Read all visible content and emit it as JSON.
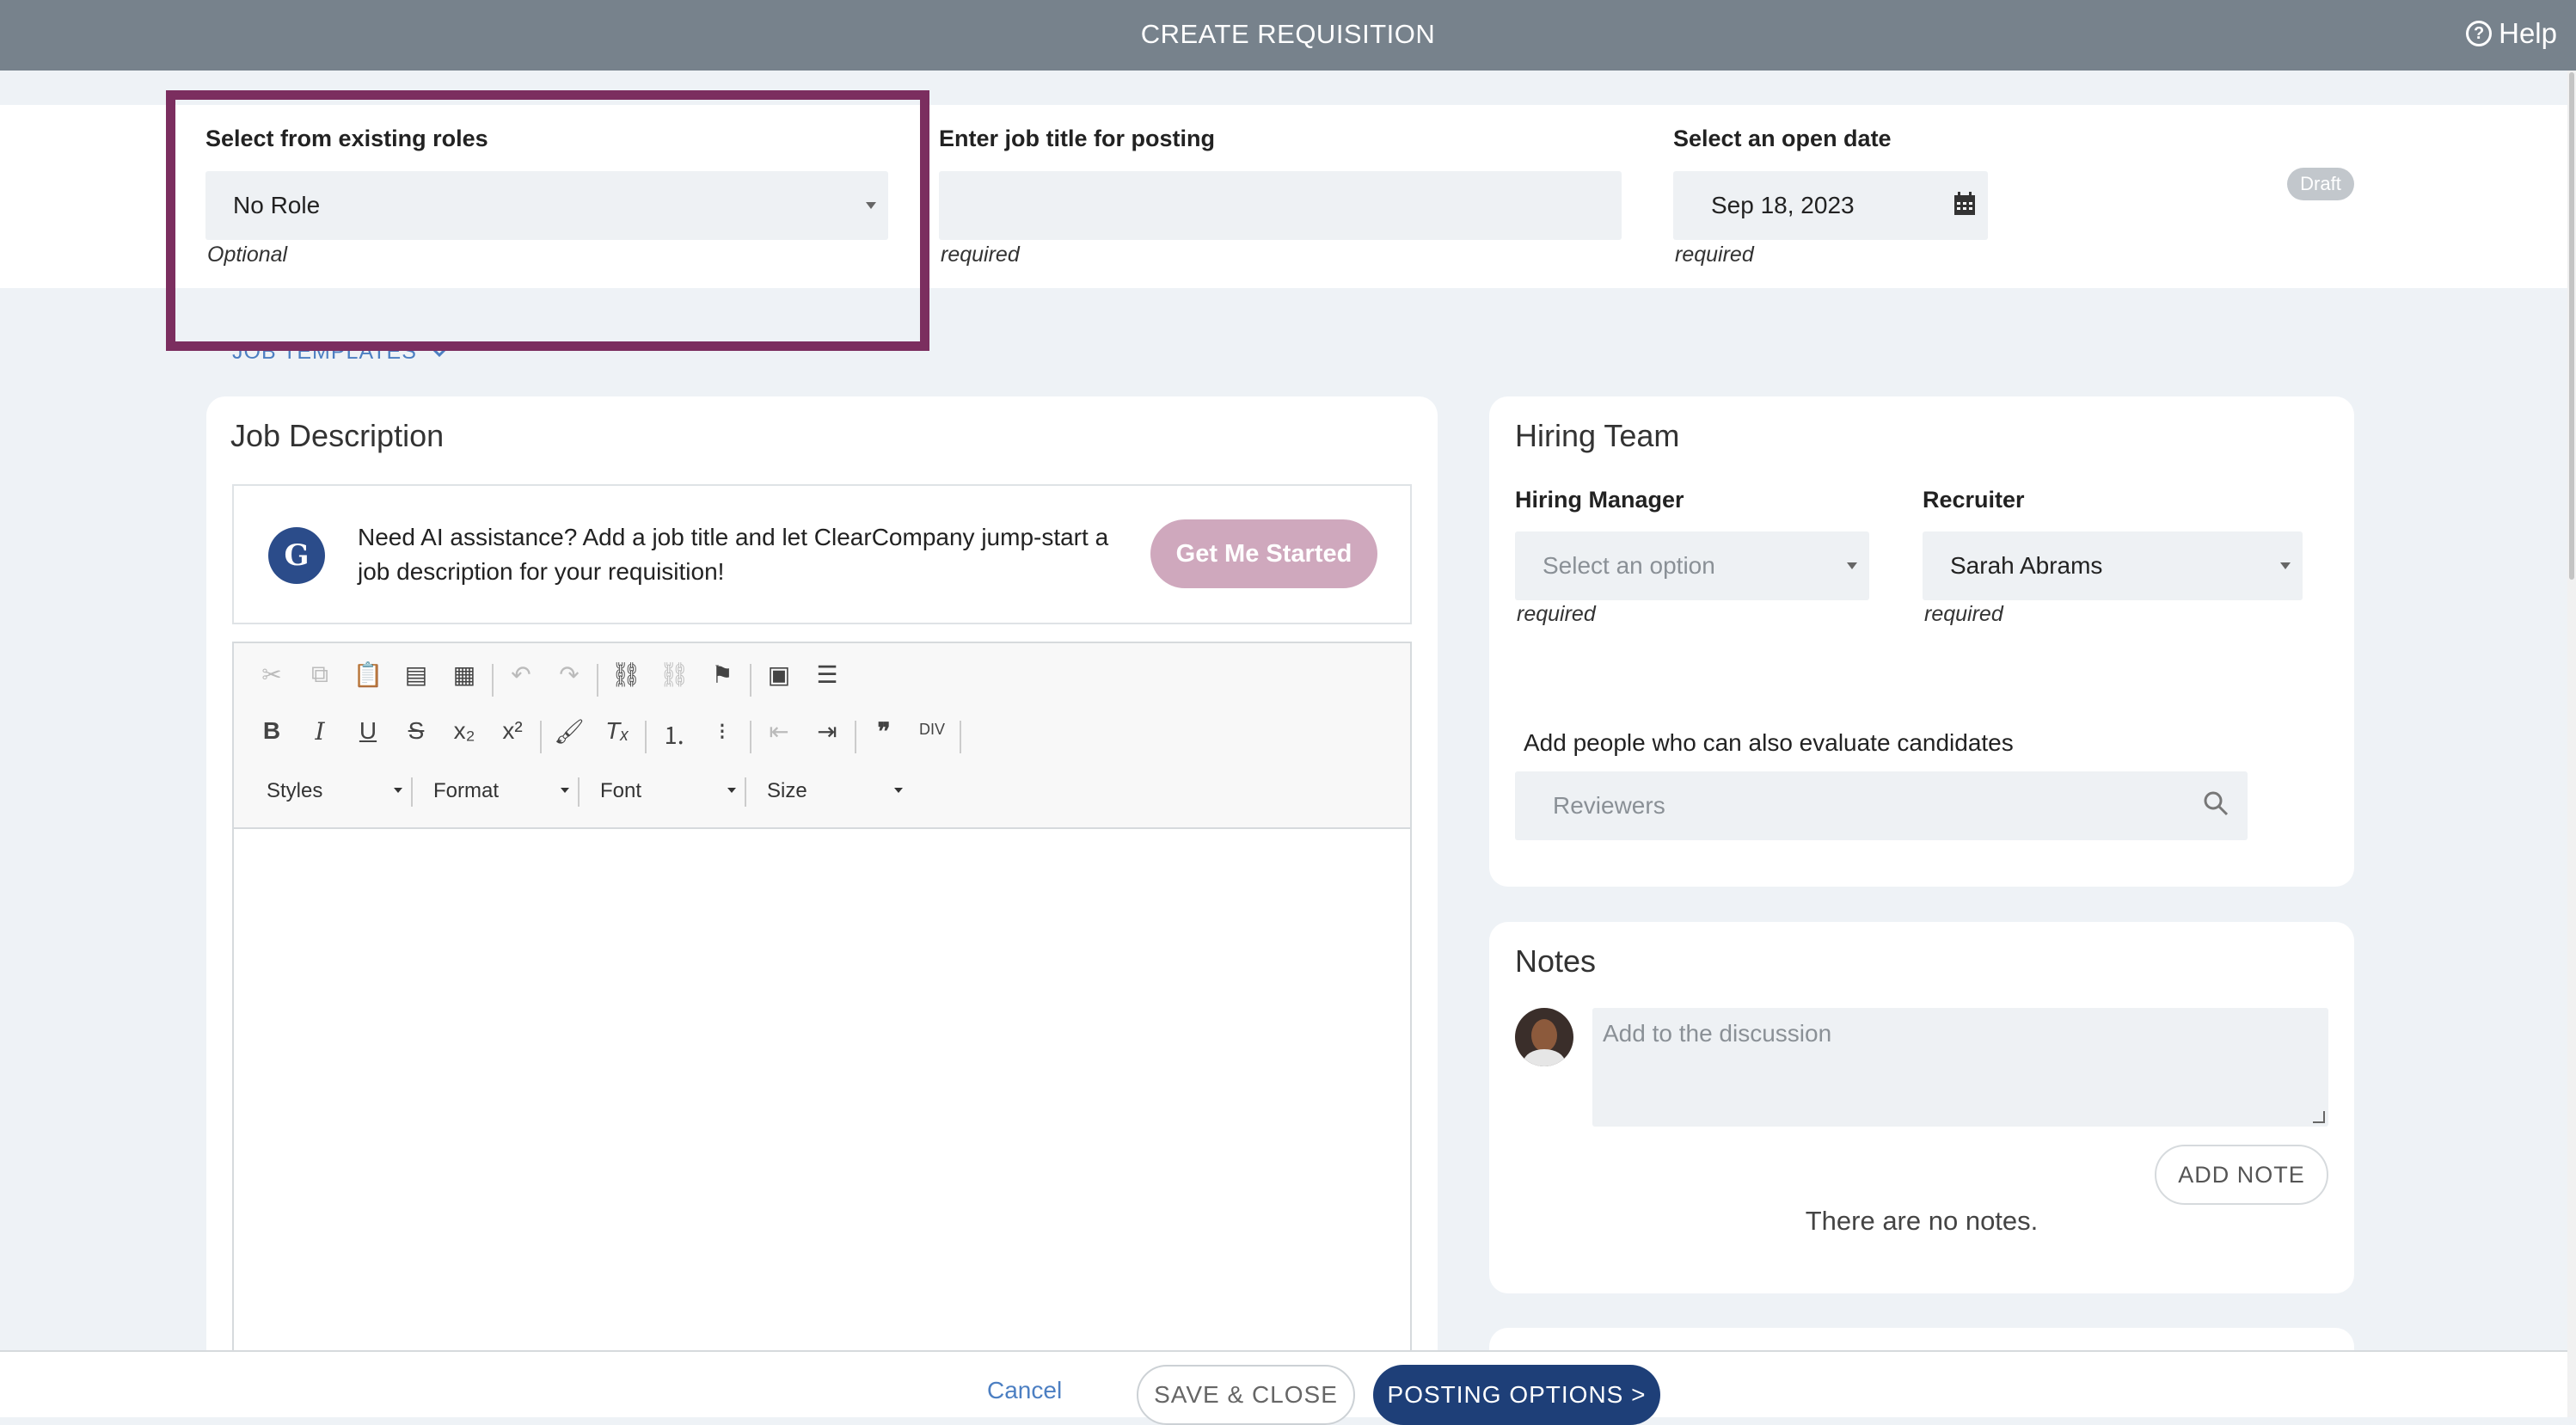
{
  "header": {
    "title": "CREATE REQUISITION",
    "help_label": "Help"
  },
  "top_fields": {
    "roles": {
      "label": "Select from existing roles",
      "value": "No Role",
      "hint": "Optional"
    },
    "job_title": {
      "label": "Enter job title for posting",
      "value": "",
      "hint": "required"
    },
    "open_date": {
      "label": "Select an open date",
      "value": "Sep 18, 2023",
      "hint": "required"
    },
    "status_badge": "Draft"
  },
  "job_templates_label": "JOB TEMPLATES",
  "job_description": {
    "title": "Job Description",
    "ai_logo": "G",
    "ai_text": "Need AI assistance? Add a job title and let ClearCompany jump-start a job description for your requisition!",
    "ai_button": "Get Me Started",
    "toolbar_combos": [
      "Styles",
      "Format",
      "Font",
      "Size"
    ],
    "icons": [
      "cut-icon",
      "copy-icon",
      "paste-icon",
      "paste-text-icon",
      "paste-word-icon",
      "undo-icon",
      "redo-icon",
      "link-icon",
      "unlink-icon",
      "anchor-icon",
      "image-icon",
      "horizontal-line-icon",
      "bold-icon",
      "italic-icon",
      "underline-icon",
      "strikethrough-icon",
      "subscript-icon",
      "superscript-icon",
      "copy-format-icon",
      "remove-format-icon",
      "numbered-list-icon",
      "bulleted-list-icon",
      "decrease-indent-icon",
      "increase-indent-icon",
      "blockquote-icon",
      "create-div-icon"
    ]
  },
  "hiring_team": {
    "title": "Hiring Team",
    "manager": {
      "label": "Hiring Manager",
      "placeholder": "Select an option",
      "hint": "required"
    },
    "recruiter": {
      "label": "Recruiter",
      "value": "Sarah Abrams",
      "hint": "required"
    },
    "reviewers_label": "Add people who can also evaluate candidates",
    "reviewers_placeholder": "Reviewers"
  },
  "notes": {
    "title": "Notes",
    "placeholder": "Add to the discussion",
    "add_button": "ADD NOTE",
    "empty_text": "There are no notes."
  },
  "footer": {
    "cancel": "Cancel",
    "save_close": "SAVE & CLOSE",
    "posting_options": "POSTING OPTIONS >"
  },
  "colors": {
    "header_bg": "#77828c",
    "highlight": "#7b2e5f",
    "primary": "#1e3f78",
    "link": "#4c7fc2",
    "ai_button": "#cfa8bd"
  }
}
